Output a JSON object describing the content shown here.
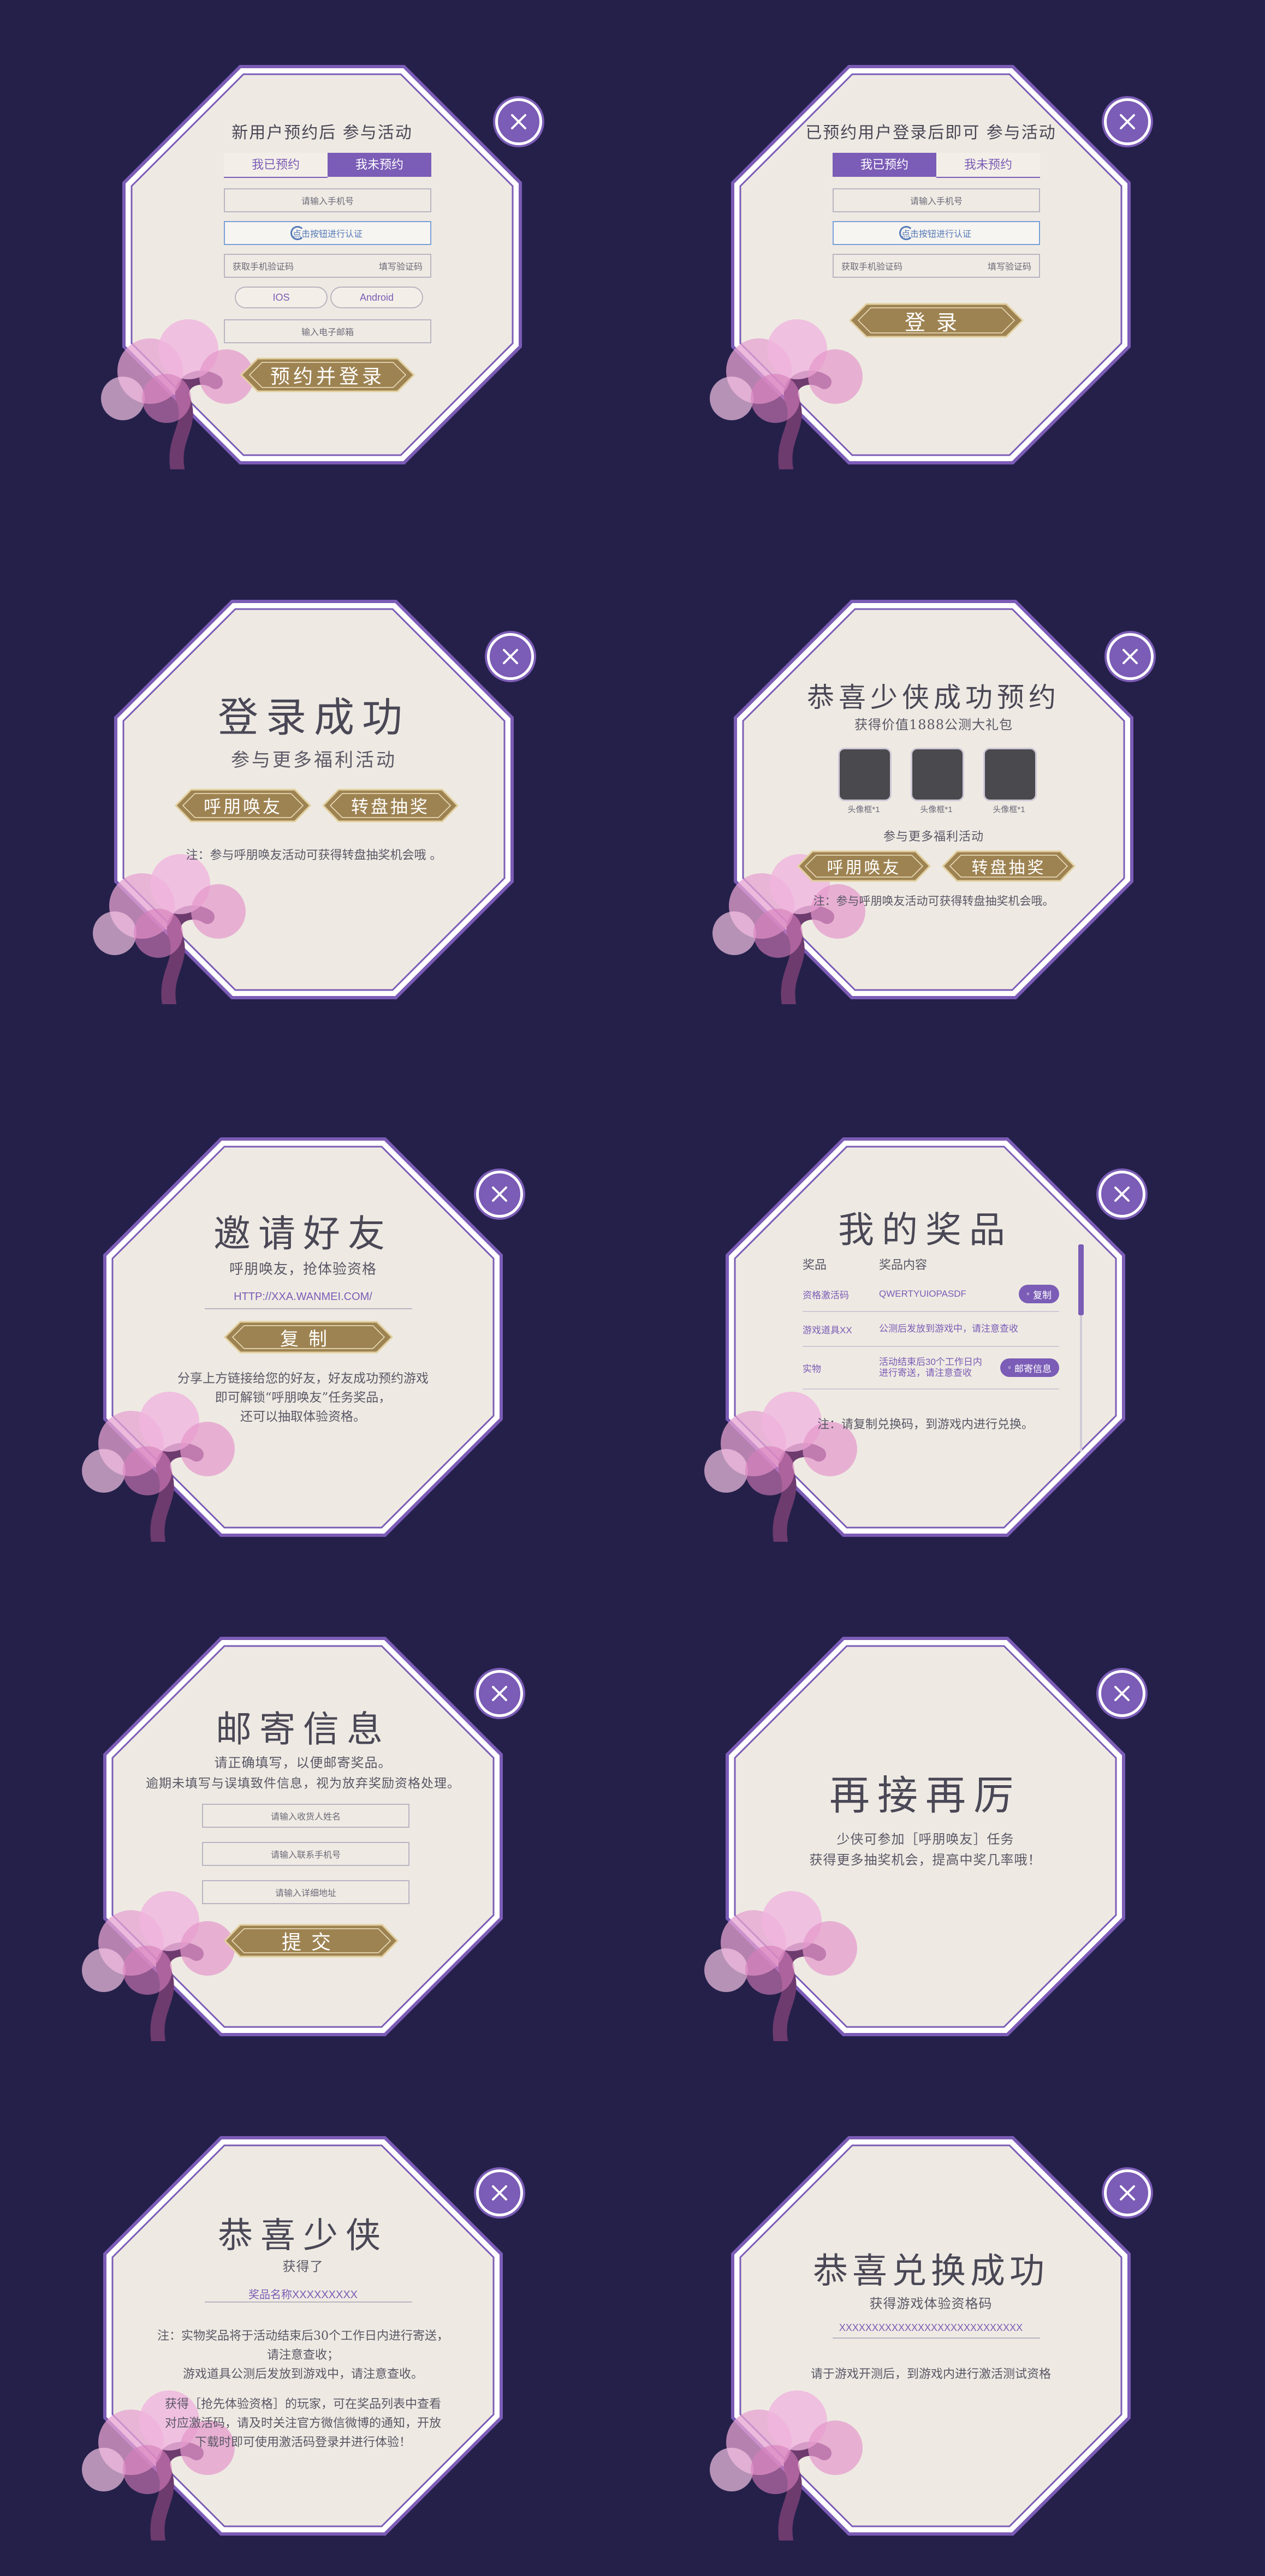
{
  "colors": {
    "background": "#24204a",
    "accent": "#7b5cb6",
    "gold": "#9e8352",
    "card": "#eeeae3"
  },
  "icons": {
    "close": "close-icon",
    "spinner": "verify-spinner-icon",
    "blossom": "cherry-blossom-decoration"
  },
  "p1": {
    "title": "新用户预约后 参与活动",
    "tab_booked": "我已预约",
    "tab_not_booked": "我未预约",
    "phone_placeholder": "请输入手机号",
    "verify_label": "点击按钮进行认证",
    "code_placeholder": "获取手机验证码",
    "code_btn": "填写验证码",
    "ios": "IOS",
    "android": "Android",
    "email_placeholder": "输入电子邮箱",
    "submit": "预约并登录"
  },
  "p2": {
    "title": "已预约用户登录后即可 参与活动",
    "tab_booked": "我已预约",
    "tab_not_booked": "我未预约",
    "phone_placeholder": "请输入手机号",
    "verify_label": "点击按钮进行认证",
    "code_placeholder": "获取手机验证码",
    "code_btn": "填写验证码",
    "submit": "登录"
  },
  "p3": {
    "title": "登录成功",
    "subtitle": "参与更多福利活动",
    "btn_invite": "呼朋唤友",
    "btn_lottery": "转盘抽奖",
    "note": "注：参与呼朋唤友活动可获得转盘抽奖机会哦 。"
  },
  "p4": {
    "title": "恭喜少侠成功预约",
    "subtitle": "获得价值1888公测大礼包",
    "gift_label": "头像框*1",
    "more": "参与更多福利活动",
    "btn_invite": "呼朋唤友",
    "btn_lottery": "转盘抽奖",
    "note": "注：参与呼朋唤友活动可获得转盘抽奖机会哦。"
  },
  "p5": {
    "title": "邀请好友",
    "subtitle": "呼朋唤友，抢体验资格",
    "link": "HTTP://XXA.WANMEI.COM/",
    "copy": "复制",
    "desc1": "分享上方链接给您的好友，好友成功预约游戏",
    "desc2": "即可解锁“呼朋唤友”任务奖品，",
    "desc3": "还可以抽取体验资格。"
  },
  "p6": {
    "title": "我的奖品",
    "col_prize": "奖品",
    "col_content": "奖品内容",
    "rows": [
      {
        "name": "资格激活码",
        "content": "QWERTYUIOPASDF",
        "btn": "复制"
      },
      {
        "name": "游戏道具XX",
        "content": "公测后发放到游戏中，请注意查收",
        "btn": ""
      },
      {
        "name": "实物",
        "content": "活动结束后30个工作日内进行寄送，请注意查收",
        "btn": "邮寄信息"
      }
    ],
    "note": "注：请复制兑换码，到游戏内进行兑换。"
  },
  "p7": {
    "title": "邮寄信息",
    "line1": "请正确填写，以便邮寄奖品。",
    "line2": "逾期未填写与误填致件信息，视为放弃奖励资格处理。",
    "name_placeholder": "请输入收货人姓名",
    "phone_placeholder": "请输入联系手机号",
    "address_placeholder": "请输入详细地址",
    "submit": "提交"
  },
  "p8": {
    "title": "再接再厉",
    "line1": "少侠可参加［呼朋唤友］任务",
    "line2": "获得更多抽奖机会，提高中奖几率哦！"
  },
  "p9": {
    "title": "恭喜少侠",
    "subtitle": "获得了",
    "prize": "奖品名称XXXXXXXXX",
    "n1": "注：实物奖品将于活动结束后30个工作日内进行寄送，",
    "n2": "请注意查收；",
    "n3": "游戏道具公测后发放到游戏中，请注意查收。",
    "n4": "获得［抢先体验资格］的玩家，可在奖品列表中查看",
    "n5": "对应激活码，请及时关注官方微信微博的通知，开放",
    "n6": "下载时即可使用激活码登录并进行体验！"
  },
  "p10": {
    "title": "恭喜兑换成功",
    "subtitle": "获得游戏体验资格码",
    "code": "XXXXXXXXXXXXXXXXXXXXXXXXXXXX",
    "note": "请于游戏开测后，到游戏内进行激活测试资格"
  }
}
